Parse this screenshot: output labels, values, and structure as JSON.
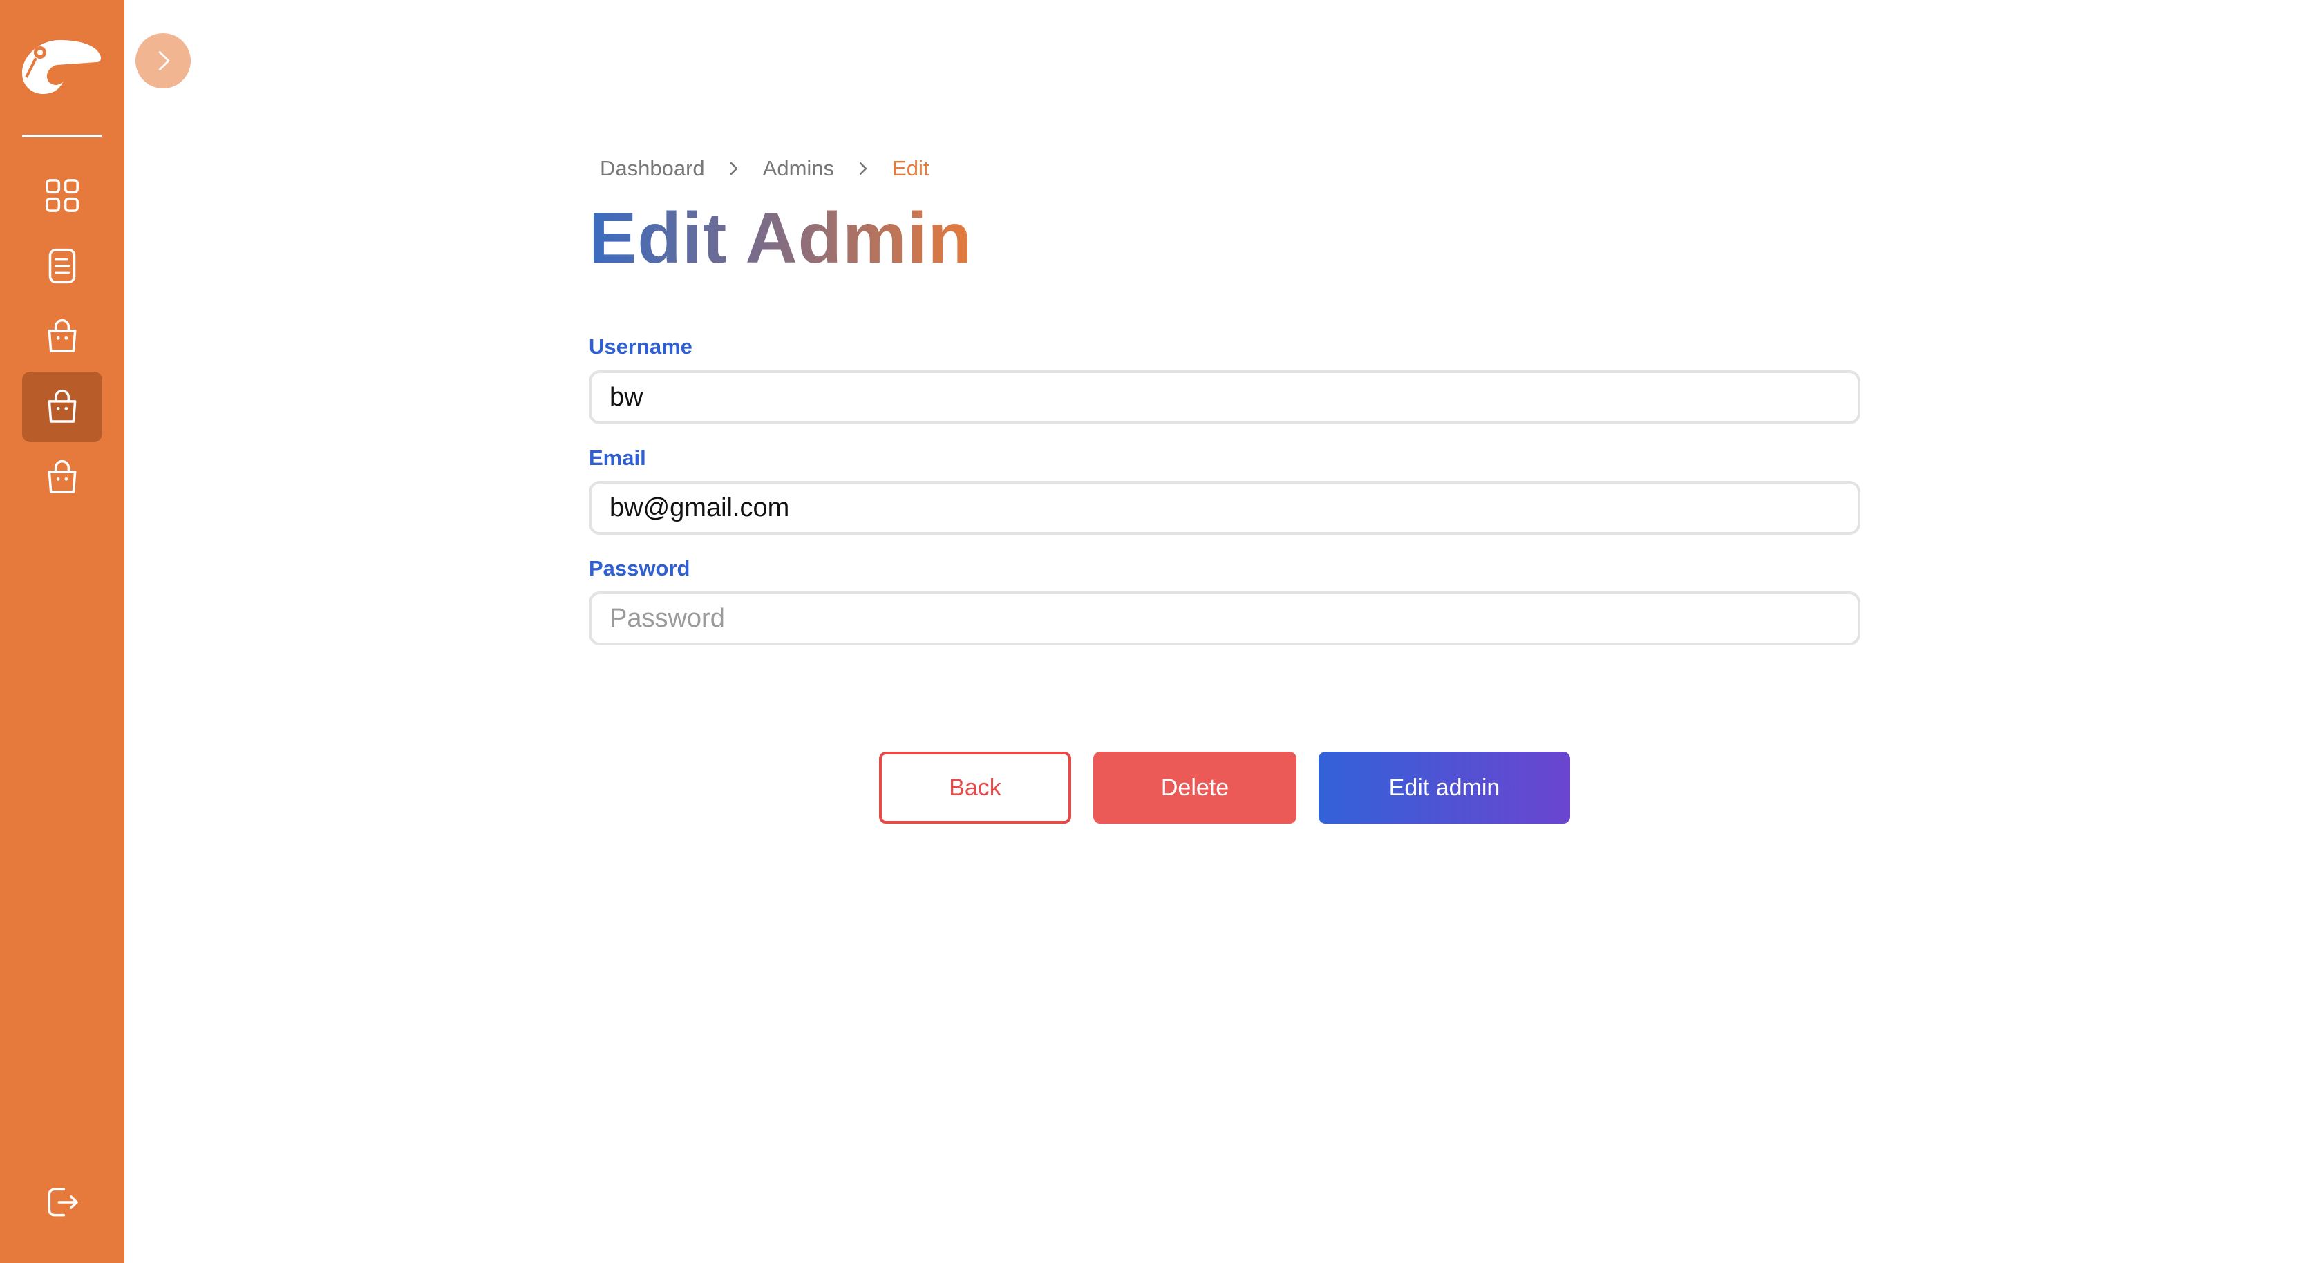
{
  "sidebar": {
    "items": [
      {
        "icon": "grid-icon",
        "active": false
      },
      {
        "icon": "document-icon",
        "active": false
      },
      {
        "icon": "shopping-bag-icon",
        "active": false
      },
      {
        "icon": "shopping-bag-icon",
        "active": true
      },
      {
        "icon": "shopping-bag-icon",
        "active": false
      }
    ],
    "logout_icon": "logout-icon"
  },
  "breadcrumb": {
    "items": [
      "Dashboard",
      "Admins",
      "Edit"
    ]
  },
  "page": {
    "title": "Edit Admin"
  },
  "form": {
    "username": {
      "label": "Username",
      "value": "bw",
      "placeholder": ""
    },
    "email": {
      "label": "Email",
      "value": "bw@gmail.com",
      "placeholder": ""
    },
    "password": {
      "label": "Password",
      "value": "",
      "placeholder": "Password"
    }
  },
  "actions": {
    "back_label": "Back",
    "delete_label": "Delete",
    "edit_label": "Edit admin"
  },
  "colors": {
    "sidebar": "#e57a3c",
    "sidebar_active": "#b85d2a",
    "label": "#2f5fd0",
    "breadcrumb_active": "#e57a3c",
    "delete": "#ec5a58",
    "back_border": "#e84a4a",
    "edit_gradient_start": "#3262d8",
    "edit_gradient_end": "#6b45cf"
  }
}
